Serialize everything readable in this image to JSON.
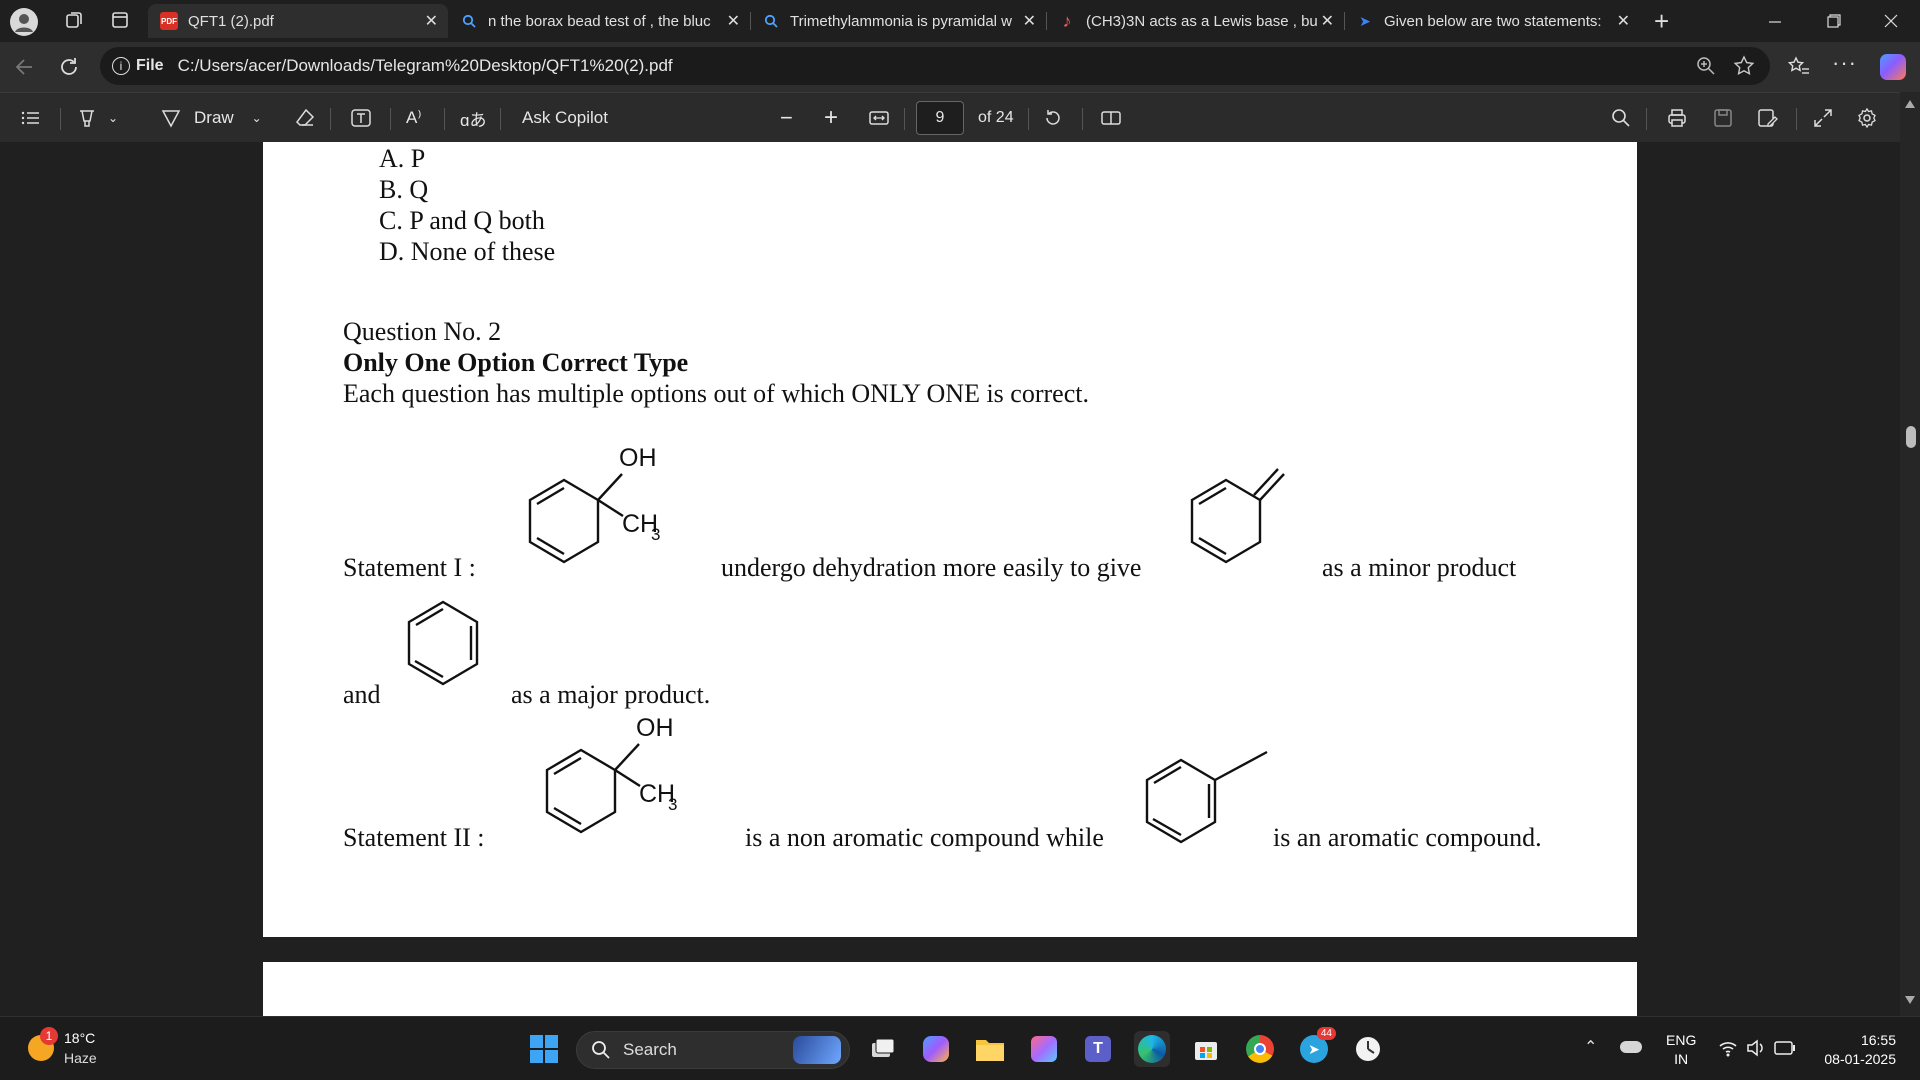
{
  "browser": {
    "tabs": [
      {
        "title": "QFT1 (2).pdf",
        "icon": "pdf-icon",
        "active": true
      },
      {
        "title": "n the borax bead test of , the bluc",
        "icon": "search-icon"
      },
      {
        "title": "Trimethylammonia is pyramidal w",
        "icon": "search-icon"
      },
      {
        "title": "(CH3)3N acts as a Lewis base , bu",
        "icon": "music-note-icon"
      },
      {
        "title": "Given below are two statements:",
        "icon": "copilot-icon"
      }
    ],
    "address": {
      "scheme_label": "File",
      "url": "C:/Users/acer/Downloads/Telegram%20Desktop/QFT1%20(2).pdf"
    }
  },
  "pdf_toolbar": {
    "draw_label": "Draw",
    "translate_label": "ɑあ",
    "read_aloud_label": "A⁾",
    "ask_copilot_label": "Ask Copilot",
    "page_number": "9",
    "page_total": "of 24"
  },
  "document": {
    "options": [
      "A. P",
      "B. Q",
      "C. P and Q both",
      "D. None of these"
    ],
    "question_no": "Question No. 2",
    "question_type": "Only One Option Correct Type",
    "instruction": "Each question has multiple options out of which ONLY ONE is correct.",
    "statement1": {
      "label": "Statement I :",
      "text1": "undergo dehydration more easily to give",
      "text2": "as a minor product",
      "and": "and",
      "text3": "as a major product."
    },
    "statement2": {
      "label": "Statement II :",
      "text1": "is a non aromatic compound while",
      "text2": "is an aromatic compound."
    },
    "chem_labels": {
      "oh": "OH",
      "ch3_base": "CH",
      "ch3_sub": "3"
    }
  },
  "taskbar": {
    "weather_temp": "18°C",
    "weather_desc": "Haze",
    "weather_badge": "1",
    "search_label": "Search",
    "telegram_badge": "44",
    "lang_top": "ENG",
    "lang_bottom": "IN",
    "time": "16:55",
    "date": "08-01-2025"
  },
  "colors": {
    "accent": "#0078d4",
    "page": "#ffffff",
    "toolbar": "#2b2b2b"
  }
}
